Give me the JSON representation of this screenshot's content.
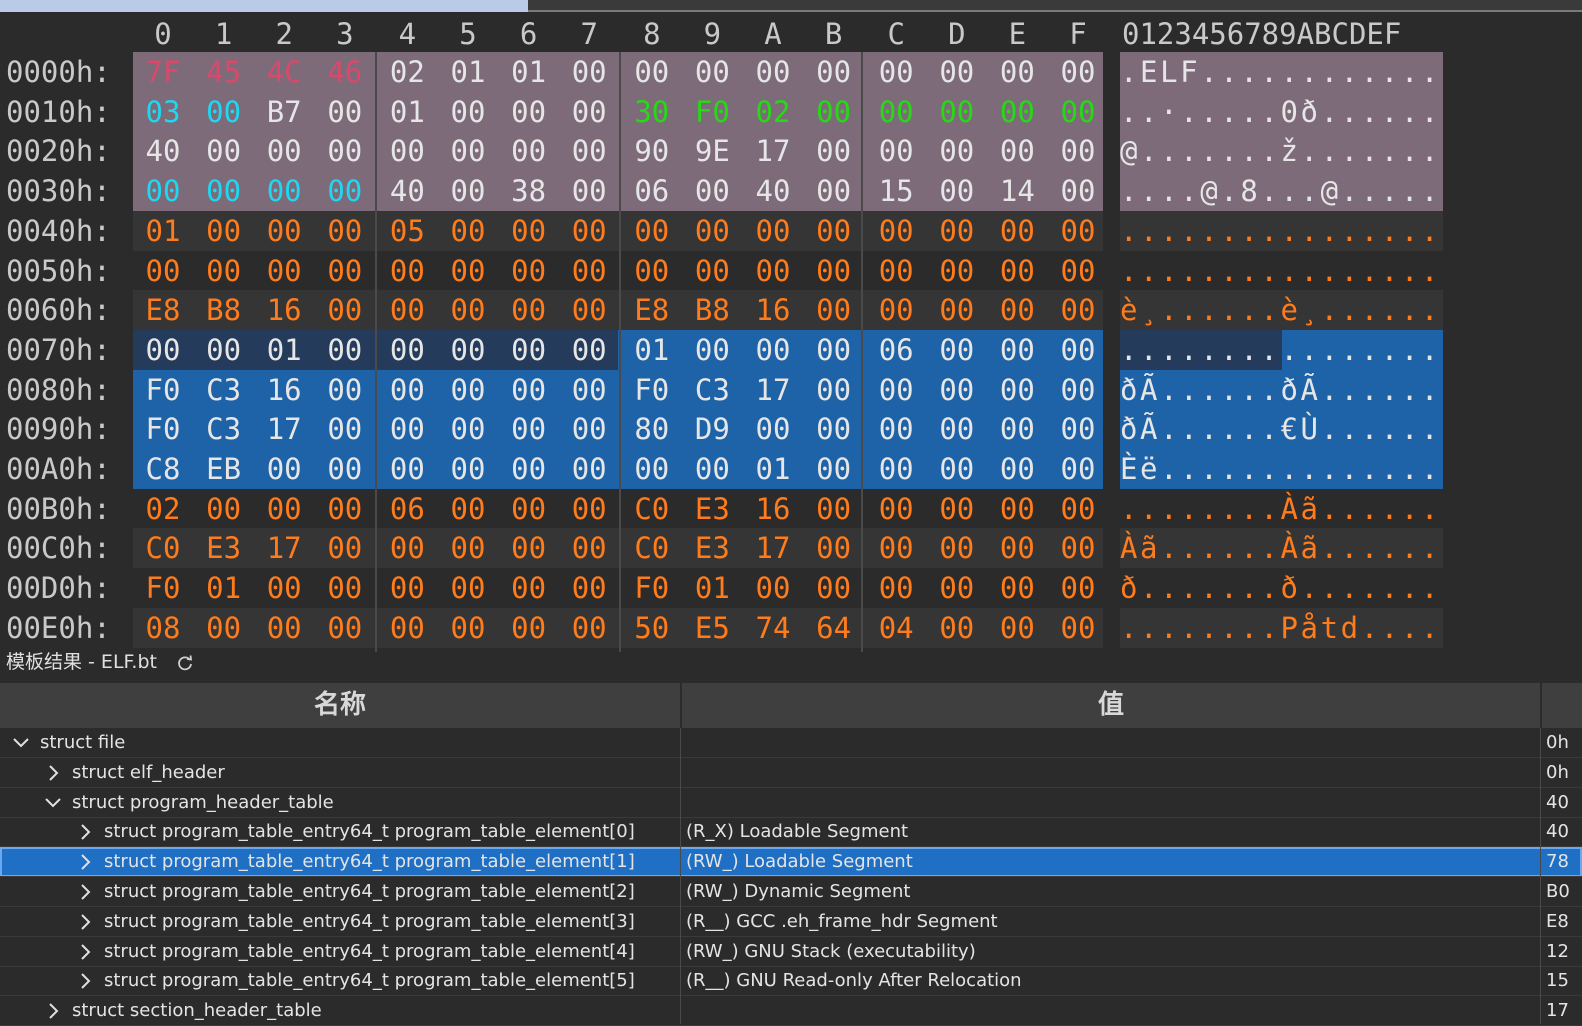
{
  "colors": {
    "red": "#d9496b",
    "cyan": "#1ed7f0",
    "green": "#27d816",
    "orange": "#ff7c1c",
    "white": "#e6e6e6",
    "header_band": "#7d6b7a",
    "dark_band": "#353535",
    "selection_band": "#1e63a8",
    "cursor_band": "#243b5c"
  },
  "hex": {
    "col_headers": [
      "0",
      "1",
      "2",
      "3",
      "4",
      "5",
      "6",
      "7",
      "8",
      "9",
      "A",
      "B",
      "C",
      "D",
      "E",
      "F"
    ],
    "ascii_header": "0123456789ABCDEF",
    "rows": [
      {
        "label": "0000h:",
        "bytes": [
          "7F",
          "45",
          "4C",
          "46",
          "02",
          "01",
          "01",
          "00",
          "00",
          "00",
          "00",
          "00",
          "00",
          "00",
          "00",
          "00"
        ],
        "ascii": ".ELF............"
      },
      {
        "label": "0010h:",
        "bytes": [
          "03",
          "00",
          "B7",
          "00",
          "01",
          "00",
          "00",
          "00",
          "30",
          "F0",
          "02",
          "00",
          "00",
          "00",
          "00",
          "00"
        ],
        "ascii": "..·.....0ð......"
      },
      {
        "label": "0020h:",
        "bytes": [
          "40",
          "00",
          "00",
          "00",
          "00",
          "00",
          "00",
          "00",
          "90",
          "9E",
          "17",
          "00",
          "00",
          "00",
          "00",
          "00"
        ],
        "ascii": "@.......ž......."
      },
      {
        "label": "0030h:",
        "bytes": [
          "00",
          "00",
          "00",
          "00",
          "40",
          "00",
          "38",
          "00",
          "06",
          "00",
          "40",
          "00",
          "15",
          "00",
          "14",
          "00"
        ],
        "ascii": "....@.8...@....."
      },
      {
        "label": "0040h:",
        "bytes": [
          "01",
          "00",
          "00",
          "00",
          "05",
          "00",
          "00",
          "00",
          "00",
          "00",
          "00",
          "00",
          "00",
          "00",
          "00",
          "00"
        ],
        "ascii": "................"
      },
      {
        "label": "0050h:",
        "bytes": [
          "00",
          "00",
          "00",
          "00",
          "00",
          "00",
          "00",
          "00",
          "00",
          "00",
          "00",
          "00",
          "00",
          "00",
          "00",
          "00"
        ],
        "ascii": "................"
      },
      {
        "label": "0060h:",
        "bytes": [
          "E8",
          "B8",
          "16",
          "00",
          "00",
          "00",
          "00",
          "00",
          "E8",
          "B8",
          "16",
          "00",
          "00",
          "00",
          "00",
          "00"
        ],
        "ascii": "è¸......è¸......"
      },
      {
        "label": "0070h:",
        "bytes": [
          "00",
          "00",
          "01",
          "00",
          "00",
          "00",
          "00",
          "00",
          "01",
          "00",
          "00",
          "00",
          "06",
          "00",
          "00",
          "00"
        ],
        "ascii": "................"
      },
      {
        "label": "0080h:",
        "bytes": [
          "F0",
          "C3",
          "16",
          "00",
          "00",
          "00",
          "00",
          "00",
          "F0",
          "C3",
          "17",
          "00",
          "00",
          "00",
          "00",
          "00"
        ],
        "ascii": "ðÃ......ðÃ......"
      },
      {
        "label": "0090h:",
        "bytes": [
          "F0",
          "C3",
          "17",
          "00",
          "00",
          "00",
          "00",
          "00",
          "80",
          "D9",
          "00",
          "00",
          "00",
          "00",
          "00",
          "00"
        ],
        "ascii": "ðÃ......€Ù......"
      },
      {
        "label": "00A0h:",
        "bytes": [
          "C8",
          "EB",
          "00",
          "00",
          "00",
          "00",
          "00",
          "00",
          "00",
          "00",
          "01",
          "00",
          "00",
          "00",
          "00",
          "00"
        ],
        "ascii": "Èë.............."
      },
      {
        "label": "00B0h:",
        "bytes": [
          "02",
          "00",
          "00",
          "00",
          "06",
          "00",
          "00",
          "00",
          "C0",
          "E3",
          "16",
          "00",
          "00",
          "00",
          "00",
          "00"
        ],
        "ascii": "........Àã......"
      },
      {
        "label": "00C0h:",
        "bytes": [
          "C0",
          "E3",
          "17",
          "00",
          "00",
          "00",
          "00",
          "00",
          "C0",
          "E3",
          "17",
          "00",
          "00",
          "00",
          "00",
          "00"
        ],
        "ascii": "Àã......Àã......"
      },
      {
        "label": "00D0h:",
        "bytes": [
          "F0",
          "01",
          "00",
          "00",
          "00",
          "00",
          "00",
          "00",
          "F0",
          "01",
          "00",
          "00",
          "00",
          "00",
          "00",
          "00"
        ],
        "ascii": "ð.......ð......."
      },
      {
        "label": "00E0h:",
        "bytes": [
          "08",
          "00",
          "00",
          "00",
          "00",
          "00",
          "00",
          "00",
          "50",
          "E5",
          "74",
          "64",
          "04",
          "00",
          "00",
          "00"
        ],
        "ascii": "........Påtd...."
      }
    ]
  },
  "template": {
    "title": "模板结果 - ELF.bt",
    "refresh_icon": "refresh-icon",
    "columns": {
      "name": "名称",
      "value": "值"
    },
    "rows": [
      {
        "name": "struct file",
        "value": "",
        "offset": "0h",
        "indent": 0,
        "expanded": true,
        "selected": false
      },
      {
        "name": "struct elf_header",
        "value": "",
        "offset": "0h",
        "indent": 1,
        "expanded": false,
        "selected": false
      },
      {
        "name": "struct program_header_table",
        "value": "",
        "offset": "40",
        "indent": 1,
        "expanded": true,
        "selected": false
      },
      {
        "name": "struct program_table_entry64_t program_table_element[0]",
        "value": "(R_X) Loadable Segment",
        "offset": "40",
        "indent": 2,
        "expanded": false,
        "selected": false
      },
      {
        "name": "struct program_table_entry64_t program_table_element[1]",
        "value": "(RW_) Loadable Segment",
        "offset": "78",
        "indent": 2,
        "expanded": false,
        "selected": true
      },
      {
        "name": "struct program_table_entry64_t program_table_element[2]",
        "value": "(RW_) Dynamic Segment",
        "offset": "B0",
        "indent": 2,
        "expanded": false,
        "selected": false
      },
      {
        "name": "struct program_table_entry64_t program_table_element[3]",
        "value": "(R__) GCC .eh_frame_hdr Segment",
        "offset": "E8",
        "indent": 2,
        "expanded": false,
        "selected": false
      },
      {
        "name": "struct program_table_entry64_t program_table_element[4]",
        "value": "(RW_) GNU Stack (executability)",
        "offset": "12",
        "indent": 2,
        "expanded": false,
        "selected": false
      },
      {
        "name": "struct program_table_entry64_t program_table_element[5]",
        "value": "(R__) GNU Read-only After Relocation",
        "offset": "15",
        "indent": 2,
        "expanded": false,
        "selected": false
      },
      {
        "name": "struct section_header_table",
        "value": "",
        "offset": "17",
        "indent": 1,
        "expanded": false,
        "selected": false
      }
    ]
  }
}
